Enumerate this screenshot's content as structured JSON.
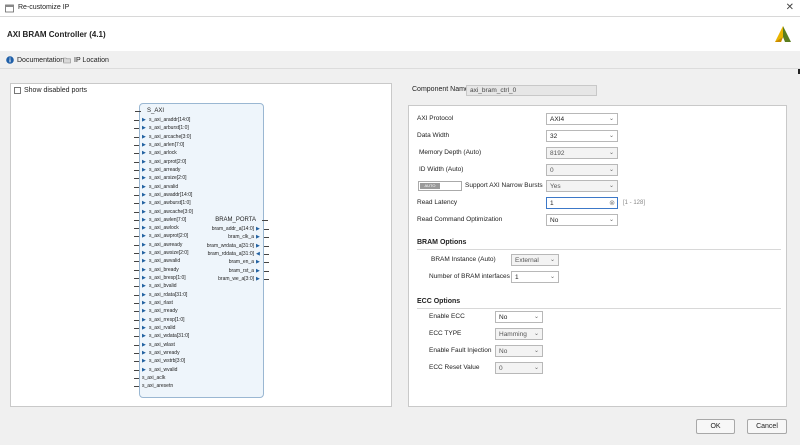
{
  "window": {
    "title": "Re-customize IP",
    "close_icon": "close-icon"
  },
  "header": {
    "ip_name": "AXI BRAM Controller (4.1)",
    "logo_icon": "xilinx-logo-icon"
  },
  "links": {
    "documentation": "Documentation",
    "ip_location": "IP Location"
  },
  "left_panel": {
    "show_disabled_ports": "Show disabled ports",
    "bus_label": "S_AXI",
    "bram_label": "BRAM_PORTA",
    "left_ports": [
      "s_axi_araddr[14:0]",
      "s_axi_arburst[1:0]",
      "s_axi_arcache[3:0]",
      "s_axi_arlen[7:0]",
      "s_axi_arlock",
      "s_axi_arprot[2:0]",
      "s_axi_arready",
      "s_axi_arsize[2:0]",
      "s_axi_arvalid",
      "s_axi_awaddr[14:0]",
      "s_axi_awburst[1:0]",
      "s_axi_awcache[3:0]",
      "s_axi_awlen[7:0]",
      "s_axi_awlock",
      "s_axi_awprot[2:0]",
      "s_axi_awready",
      "s_axi_awsize[2:0]",
      "s_axi_awvalid",
      "s_axi_bready",
      "s_axi_bresp[1:0]",
      "s_axi_bvalid",
      "s_axi_rdata[31:0]",
      "s_axi_rlast",
      "s_axi_rready",
      "s_axi_rresp[1:0]",
      "s_axi_rvalid",
      "s_axi_wdata[31:0]",
      "s_axi_wlast",
      "s_axi_wready",
      "s_axi_wstrb[3:0]",
      "s_axi_wvalid"
    ],
    "clock_ports": [
      "s_axi_aclk",
      "s_axi_aresetn"
    ],
    "right_ports": [
      "bram_addr_a[14:0]",
      "bram_clk_a",
      "bram_wrdata_a[31:0]",
      "bram_rddata_a[31:0]",
      "bram_en_a",
      "bram_rst_a",
      "bram_we_a[3:0]"
    ]
  },
  "right_panel": {
    "component_name_label": "Component Name",
    "component_name_value": "axi_bram_ctrl_0",
    "axi_protocol": {
      "label": "AXI Protocol",
      "value": "AXI4"
    },
    "data_width": {
      "label": "Data Width",
      "value": "32"
    },
    "memory_depth": {
      "label": "Memory Depth (Auto)",
      "value": "8192"
    },
    "id_width": {
      "label": "ID Width (Auto)",
      "value": "0"
    },
    "narrow_bursts": {
      "toggle_label": "AUTO",
      "label": "Support AXI Narrow Bursts",
      "value": "Yes"
    },
    "read_latency": {
      "label": "Read Latency",
      "value": "1",
      "range": "[1 - 128]"
    },
    "read_cmd_opt": {
      "label": "Read Command Optimization",
      "value": "No"
    },
    "bram_options": {
      "title": "BRAM Options",
      "instance": {
        "label": "BRAM Instance (Auto)",
        "value": "External"
      },
      "num_interfaces": {
        "label": "Number of BRAM interfaces",
        "value": "1"
      }
    },
    "ecc_options": {
      "title": "ECC Options",
      "enable_ecc": {
        "label": "Enable ECC",
        "value": "No"
      },
      "ecc_type": {
        "label": "ECC TYPE",
        "value": "Hamming"
      },
      "fault_injection": {
        "label": "Enable Fault Injection",
        "value": "No"
      },
      "reset_value": {
        "label": "ECC Reset Value",
        "value": "0"
      }
    }
  },
  "footer": {
    "ok": "OK",
    "cancel": "Cancel"
  }
}
